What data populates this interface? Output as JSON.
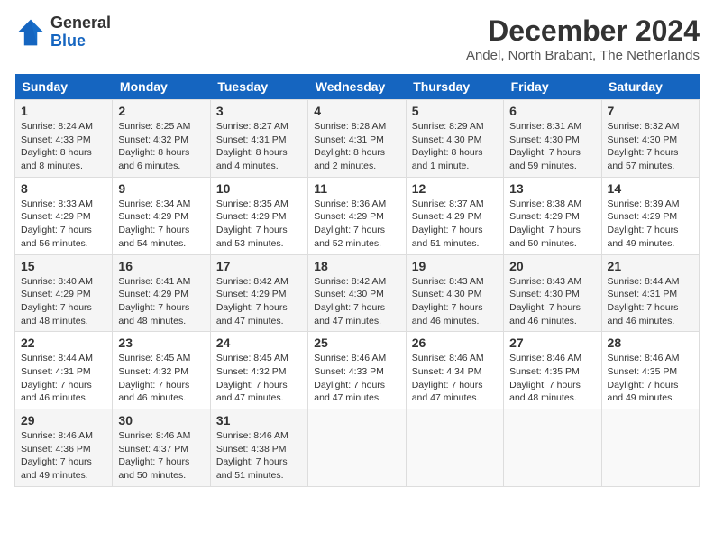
{
  "header": {
    "logo_line1": "General",
    "logo_line2": "Blue",
    "month": "December 2024",
    "location": "Andel, North Brabant, The Netherlands"
  },
  "days_of_week": [
    "Sunday",
    "Monday",
    "Tuesday",
    "Wednesday",
    "Thursday",
    "Friday",
    "Saturday"
  ],
  "weeks": [
    [
      {
        "day": "1",
        "info": "Sunrise: 8:24 AM\nSunset: 4:33 PM\nDaylight: 8 hours\nand 8 minutes."
      },
      {
        "day": "2",
        "info": "Sunrise: 8:25 AM\nSunset: 4:32 PM\nDaylight: 8 hours\nand 6 minutes."
      },
      {
        "day": "3",
        "info": "Sunrise: 8:27 AM\nSunset: 4:31 PM\nDaylight: 8 hours\nand 4 minutes."
      },
      {
        "day": "4",
        "info": "Sunrise: 8:28 AM\nSunset: 4:31 PM\nDaylight: 8 hours\nand 2 minutes."
      },
      {
        "day": "5",
        "info": "Sunrise: 8:29 AM\nSunset: 4:30 PM\nDaylight: 8 hours\nand 1 minute."
      },
      {
        "day": "6",
        "info": "Sunrise: 8:31 AM\nSunset: 4:30 PM\nDaylight: 7 hours\nand 59 minutes."
      },
      {
        "day": "7",
        "info": "Sunrise: 8:32 AM\nSunset: 4:30 PM\nDaylight: 7 hours\nand 57 minutes."
      }
    ],
    [
      {
        "day": "8",
        "info": "Sunrise: 8:33 AM\nSunset: 4:29 PM\nDaylight: 7 hours\nand 56 minutes."
      },
      {
        "day": "9",
        "info": "Sunrise: 8:34 AM\nSunset: 4:29 PM\nDaylight: 7 hours\nand 54 minutes."
      },
      {
        "day": "10",
        "info": "Sunrise: 8:35 AM\nSunset: 4:29 PM\nDaylight: 7 hours\nand 53 minutes."
      },
      {
        "day": "11",
        "info": "Sunrise: 8:36 AM\nSunset: 4:29 PM\nDaylight: 7 hours\nand 52 minutes."
      },
      {
        "day": "12",
        "info": "Sunrise: 8:37 AM\nSunset: 4:29 PM\nDaylight: 7 hours\nand 51 minutes."
      },
      {
        "day": "13",
        "info": "Sunrise: 8:38 AM\nSunset: 4:29 PM\nDaylight: 7 hours\nand 50 minutes."
      },
      {
        "day": "14",
        "info": "Sunrise: 8:39 AM\nSunset: 4:29 PM\nDaylight: 7 hours\nand 49 minutes."
      }
    ],
    [
      {
        "day": "15",
        "info": "Sunrise: 8:40 AM\nSunset: 4:29 PM\nDaylight: 7 hours\nand 48 minutes."
      },
      {
        "day": "16",
        "info": "Sunrise: 8:41 AM\nSunset: 4:29 PM\nDaylight: 7 hours\nand 48 minutes."
      },
      {
        "day": "17",
        "info": "Sunrise: 8:42 AM\nSunset: 4:29 PM\nDaylight: 7 hours\nand 47 minutes."
      },
      {
        "day": "18",
        "info": "Sunrise: 8:42 AM\nSunset: 4:30 PM\nDaylight: 7 hours\nand 47 minutes."
      },
      {
        "day": "19",
        "info": "Sunrise: 8:43 AM\nSunset: 4:30 PM\nDaylight: 7 hours\nand 46 minutes."
      },
      {
        "day": "20",
        "info": "Sunrise: 8:43 AM\nSunset: 4:30 PM\nDaylight: 7 hours\nand 46 minutes."
      },
      {
        "day": "21",
        "info": "Sunrise: 8:44 AM\nSunset: 4:31 PM\nDaylight: 7 hours\nand 46 minutes."
      }
    ],
    [
      {
        "day": "22",
        "info": "Sunrise: 8:44 AM\nSunset: 4:31 PM\nDaylight: 7 hours\nand 46 minutes."
      },
      {
        "day": "23",
        "info": "Sunrise: 8:45 AM\nSunset: 4:32 PM\nDaylight: 7 hours\nand 46 minutes."
      },
      {
        "day": "24",
        "info": "Sunrise: 8:45 AM\nSunset: 4:32 PM\nDaylight: 7 hours\nand 47 minutes."
      },
      {
        "day": "25",
        "info": "Sunrise: 8:46 AM\nSunset: 4:33 PM\nDaylight: 7 hours\nand 47 minutes."
      },
      {
        "day": "26",
        "info": "Sunrise: 8:46 AM\nSunset: 4:34 PM\nDaylight: 7 hours\nand 47 minutes."
      },
      {
        "day": "27",
        "info": "Sunrise: 8:46 AM\nSunset: 4:35 PM\nDaylight: 7 hours\nand 48 minutes."
      },
      {
        "day": "28",
        "info": "Sunrise: 8:46 AM\nSunset: 4:35 PM\nDaylight: 7 hours\nand 49 minutes."
      }
    ],
    [
      {
        "day": "29",
        "info": "Sunrise: 8:46 AM\nSunset: 4:36 PM\nDaylight: 7 hours\nand 49 minutes."
      },
      {
        "day": "30",
        "info": "Sunrise: 8:46 AM\nSunset: 4:37 PM\nDaylight: 7 hours\nand 50 minutes."
      },
      {
        "day": "31",
        "info": "Sunrise: 8:46 AM\nSunset: 4:38 PM\nDaylight: 7 hours\nand 51 minutes."
      },
      {
        "day": "",
        "info": ""
      },
      {
        "day": "",
        "info": ""
      },
      {
        "day": "",
        "info": ""
      },
      {
        "day": "",
        "info": ""
      }
    ]
  ]
}
